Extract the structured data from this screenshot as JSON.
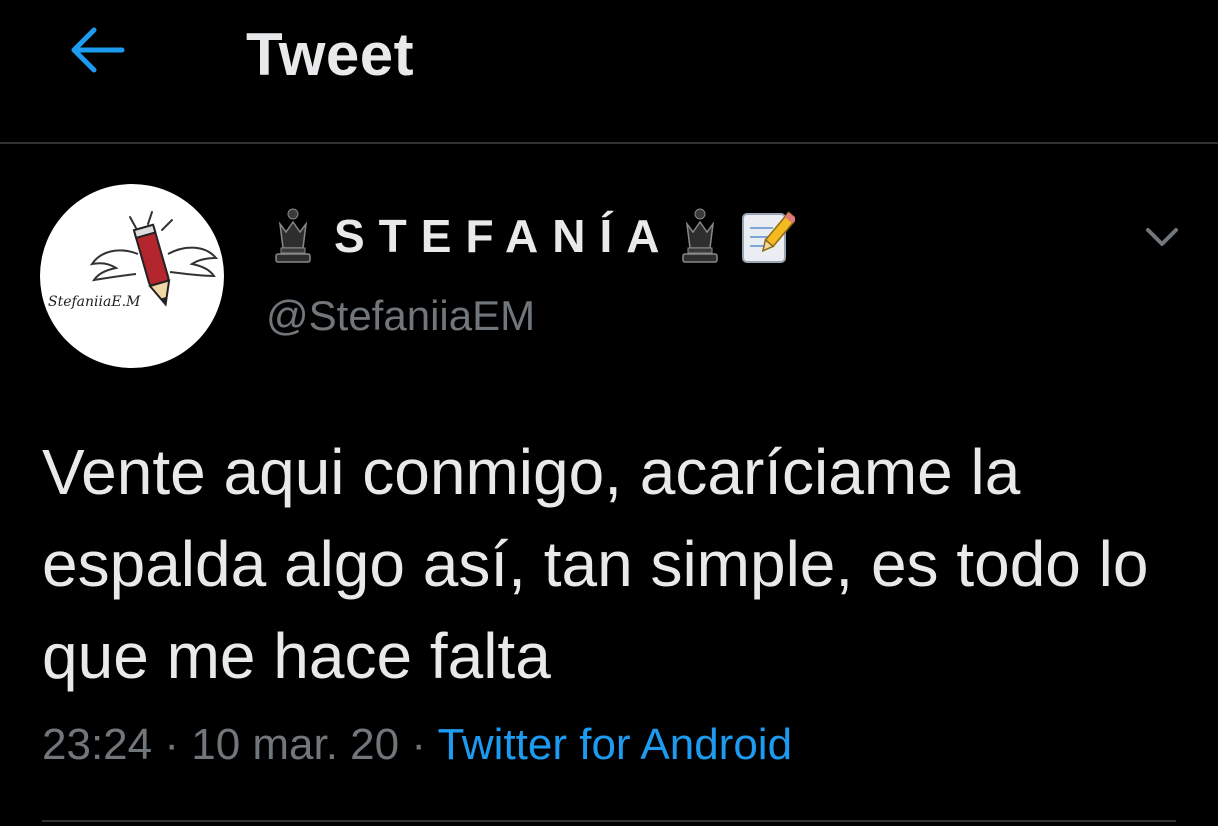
{
  "header": {
    "title": "Tweet",
    "back_icon": "arrow-left-icon"
  },
  "tweet": {
    "avatar_caption": "StefaniiaE.M",
    "display_name": "STEFANÍA",
    "name_decorations": [
      "chess-queen-icon",
      "chess-queen-icon",
      "memo-icon"
    ],
    "handle": "@StefaniiaEM",
    "text": "Vente aqui conmigo, acaríciame la espalda algo así, tan simple, es todo lo que me hace falta",
    "time": "23:24",
    "separator": " · ",
    "date": "10 mar. 20",
    "source": "Twitter for Android"
  },
  "colors": {
    "background": "#000000",
    "text": "#e7e9ea",
    "muted": "#71767b",
    "accent": "#1d9bf0",
    "divider": "#2f3336"
  }
}
